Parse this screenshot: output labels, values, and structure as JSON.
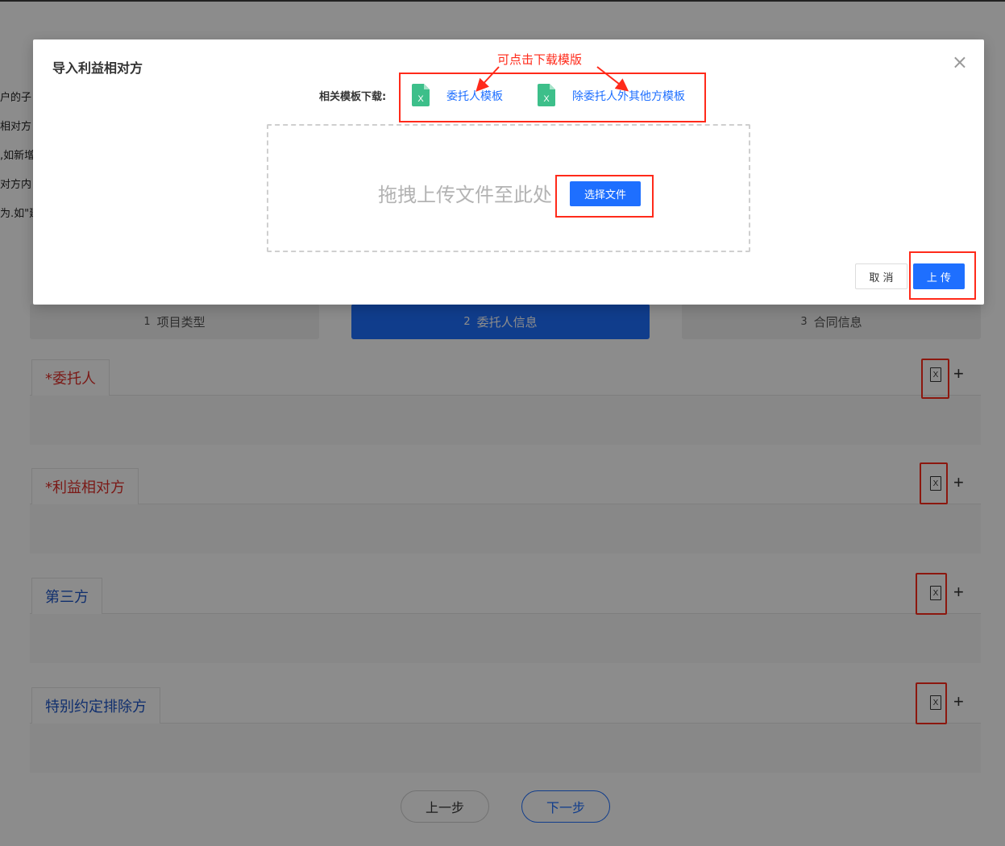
{
  "background": {
    "notes": [
      "户的子",
      "相对方",
      ",如新增",
      "对方内",
      "为.如\"建"
    ],
    "steps": [
      {
        "num": "1",
        "label": "项目类型"
      },
      {
        "num": "2",
        "label": "委托人信息"
      },
      {
        "num": "3",
        "label": "合同信息"
      }
    ],
    "sections": [
      {
        "title": "*委托人"
      },
      {
        "title": "*利益相对方"
      },
      {
        "title": "第三方"
      },
      {
        "title": "特别约定排除方"
      }
    ],
    "prev_label": "上一步",
    "next_label": "下一步",
    "xls_glyph": "X",
    "plus_glyph": "+"
  },
  "modal": {
    "title": "导入利益相对方",
    "close_glyph": "×",
    "template_label": "相关模板下载:",
    "templates": [
      {
        "label": "委托人模板",
        "icon": "excel-file-icon"
      },
      {
        "label": "除委托人外其他方模板",
        "icon": "excel-file-icon"
      }
    ],
    "annotation": "可点击下载模版",
    "drop_text": "拖拽上传文件至此处",
    "choose_label": "选择文件",
    "cancel_label": "取 消",
    "upload_label": "上 传"
  },
  "colors": {
    "primary": "#1e6fff",
    "annotation": "#ff2a1a",
    "required_title": "#e0302b",
    "optional_title": "#1e56c8",
    "excel_green": "#3dbf8a"
  }
}
